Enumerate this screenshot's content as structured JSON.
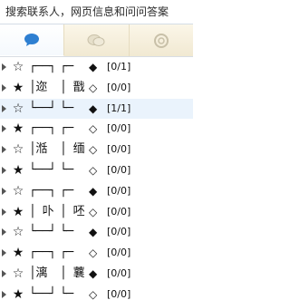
{
  "search": {
    "placeholder": "搜索联系人，网页信息和问问答案"
  },
  "tabs": [
    {
      "name": "chat-bubble-icon",
      "active": true,
      "color": "#2e7fd1"
    },
    {
      "name": "double-bubble-icon",
      "active": false,
      "color": "#c8c0a8"
    },
    {
      "name": "ring-icon",
      "active": false,
      "color": "#c8c0a8"
    }
  ],
  "rows": [
    {
      "star": "☆",
      "g1": "┌──┐",
      "g2": "┌─",
      "dia": "◆",
      "count": "[0/1]",
      "sel": false
    },
    {
      "star": "★",
      "g1": "│迩 ",
      "g2": "│ 戬",
      "dia": "◇",
      "count": "[0/0]",
      "sel": false
    },
    {
      "star": "☆",
      "g1": "└──┘",
      "g2": "└─",
      "dia": "◆",
      "count": "[1/1]",
      "sel": true
    },
    {
      "star": "★",
      "g1": "┌──┐",
      "g2": "┌─",
      "dia": "◇",
      "count": "[0/0]",
      "sel": false
    },
    {
      "star": "☆",
      "g1": "│湉 ",
      "g2": "│ 缅",
      "dia": "◇",
      "count": "[0/0]",
      "sel": false
    },
    {
      "star": "★",
      "g1": "└──┘",
      "g2": "└─",
      "dia": "◇",
      "count": "[0/0]",
      "sel": false
    },
    {
      "star": "☆",
      "g1": "┌──┐",
      "g2": "┌─",
      "dia": "◆",
      "count": "[0/0]",
      "sel": false
    },
    {
      "star": "★",
      "g1": "│ 卟 ",
      "g2": "│ 呸",
      "dia": "◇",
      "count": "[0/0]",
      "sel": false
    },
    {
      "star": "☆",
      "g1": "└──┘",
      "g2": "└─",
      "dia": "◆",
      "count": "[0/0]",
      "sel": false
    },
    {
      "star": "★",
      "g1": "┌──┐",
      "g2": "┌─",
      "dia": "◇",
      "count": "[0/0]",
      "sel": false
    },
    {
      "star": "☆",
      "g1": "│漓 ",
      "g2": "│ 蘘",
      "dia": "◆",
      "count": "[0/0]",
      "sel": false
    },
    {
      "star": "★",
      "g1": "└──┘",
      "g2": "└─",
      "dia": "◇",
      "count": "[0/0]",
      "sel": false
    }
  ]
}
